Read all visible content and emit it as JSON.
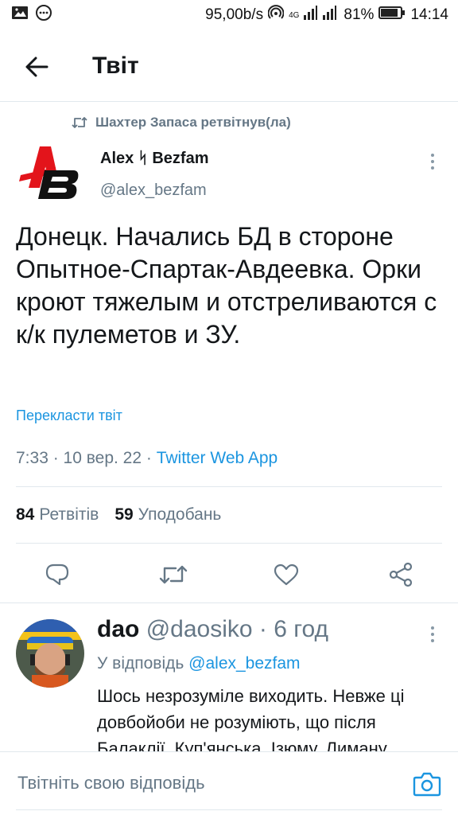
{
  "status_bar": {
    "network_speed": "95,00b/s",
    "network_type": "4G",
    "battery": "81%",
    "time": "14:14",
    "icons": [
      "image-icon",
      "chat-icon",
      "hotspot-icon",
      "signal-icon",
      "battery-icon"
    ]
  },
  "header": {
    "title": "Твіт",
    "back_icon": "arrow-left-icon"
  },
  "tweet": {
    "retweeted_by": "Шахтер Запаса ретвітнув(ла)",
    "author_name": "Alex ᛋ Bezfam",
    "author_handle": "@alex_bezfam",
    "text": "Донецк. Начались БД в стороне Опытное-Спартак-Авдеевка. Орки кроют тяжелым и отстреливаются с к/к пулеметов и ЗУ.",
    "translate_link": "Перекласти твіт",
    "time_date": "7:33 · 10 вер. 22 · ",
    "source_app": "Twitter Web App",
    "retweets_count": "84",
    "retweets_label": "Ретвітів",
    "likes_count": "59",
    "likes_label": "Уподобань"
  },
  "reply": {
    "name": "dao",
    "handle": "@daosiko",
    "time": " · 6 год",
    "reply_to_label": "У відповідь ",
    "reply_to_handle": "@alex_bezfam",
    "text": "Шось незрозуміле виходить. Невже ці довбойоби не розуміють, що після Балаклії, Куп'янська, Ізюму, Лиману"
  },
  "composer": {
    "placeholder": "Твітніть свою відповідь"
  },
  "colors": {
    "accent": "#1b95e0",
    "secondary_text": "#657786",
    "divider": "#e1e8ed",
    "logo_red": "#e3141b"
  }
}
